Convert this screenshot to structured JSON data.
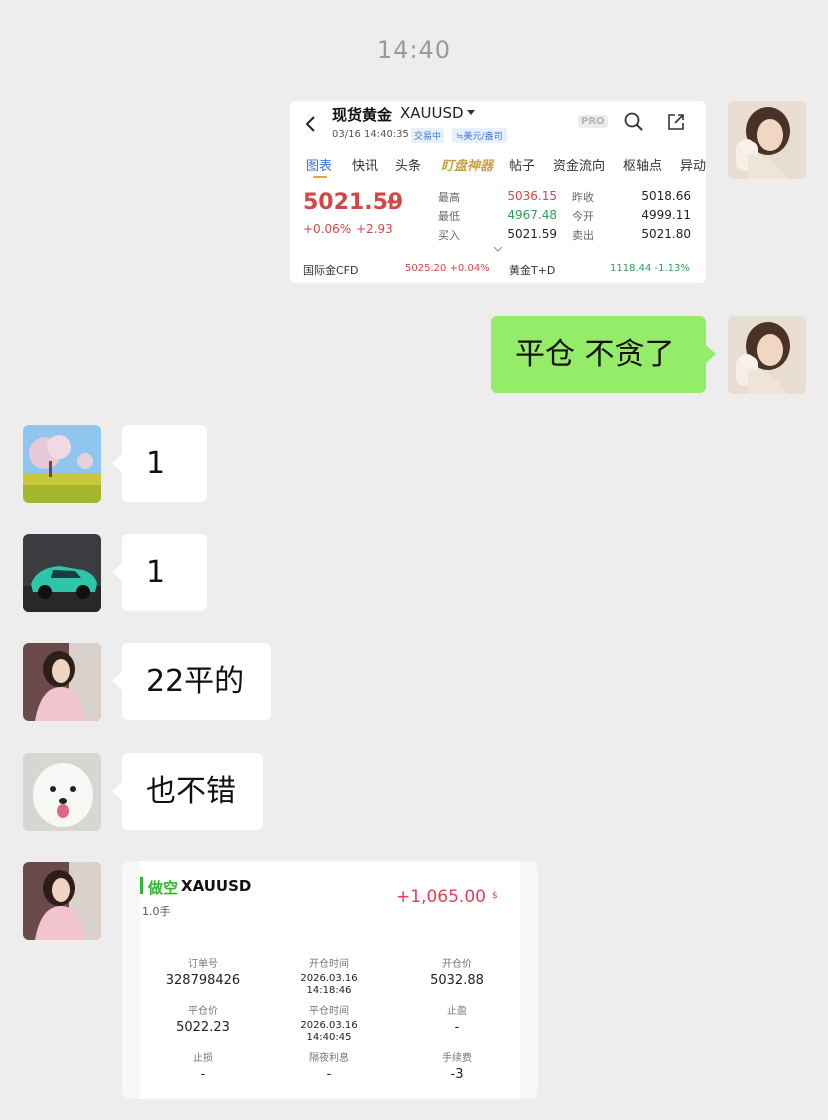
{
  "timestamp": "14:40",
  "market_card": {
    "name": "现货黄金",
    "symbol": "XAUUSD",
    "datetime": "03/16 14:40:35",
    "status": "交易中",
    "currency": "≒美元/盎司",
    "pro": "PRO",
    "tabs": [
      "图表",
      "快讯",
      "头条",
      "盯盘神器",
      "帖子",
      "资金流向",
      "枢轴点",
      "异动"
    ],
    "price": "5021.59",
    "change_pct": "+0.06%",
    "change": "+2.93",
    "stats": {
      "high_label": "最高",
      "high": "5036.15",
      "low_label": "最低",
      "low": "4967.48",
      "bid_label": "买入",
      "bid": "5021.59",
      "prev_close_label": "昨收",
      "prev_close": "5018.66",
      "open_label": "今开",
      "open": "4999.11",
      "ask_label": "卖出",
      "ask": "5021.80"
    },
    "footer": {
      "cfd_label": "国际金CFD",
      "cfd_value": "5025.20 +0.04%",
      "td_label": "黄金T+D",
      "td_value": "1118.44 -1.13%"
    }
  },
  "messages": [
    {
      "sender": "me",
      "text": "平仓 不贪了"
    },
    {
      "sender": "member1",
      "text": "1"
    },
    {
      "sender": "member2",
      "text": "1"
    },
    {
      "sender": "member3",
      "text": "22平的"
    },
    {
      "sender": "member4",
      "text": "也不错"
    }
  ],
  "trade_card": {
    "side": "做空",
    "symbol": "XAUUSD",
    "lots": "1.0手",
    "pnl": "+1,065.00",
    "pnl_unit": "$",
    "fields": [
      {
        "label": "订单号",
        "value": "328798426"
      },
      {
        "label": "开仓时间",
        "value_date": "2026.03.16",
        "value_time": "14:18:46"
      },
      {
        "label": "开仓价",
        "value": "5032.88"
      },
      {
        "label": "平仓价",
        "value": "5022.23"
      },
      {
        "label": "平仓时间",
        "value_date": "2026.03.16",
        "value_time": "14:40:45"
      },
      {
        "label": "止盈",
        "value": "-"
      },
      {
        "label": "止损",
        "value": "-"
      },
      {
        "label": "隔夜利息",
        "value": "-"
      },
      {
        "label": "手续费",
        "value": "-3"
      }
    ]
  },
  "colors": {
    "background": "#ededed",
    "my_bubble": "#95ec69",
    "other_bubble": "#ffffff",
    "price_up": "#d24848",
    "price_down": "#2e9e5b",
    "short_side": "#2eb82e",
    "profit": "#e0405a",
    "active_tab": "#3b6fd8"
  }
}
